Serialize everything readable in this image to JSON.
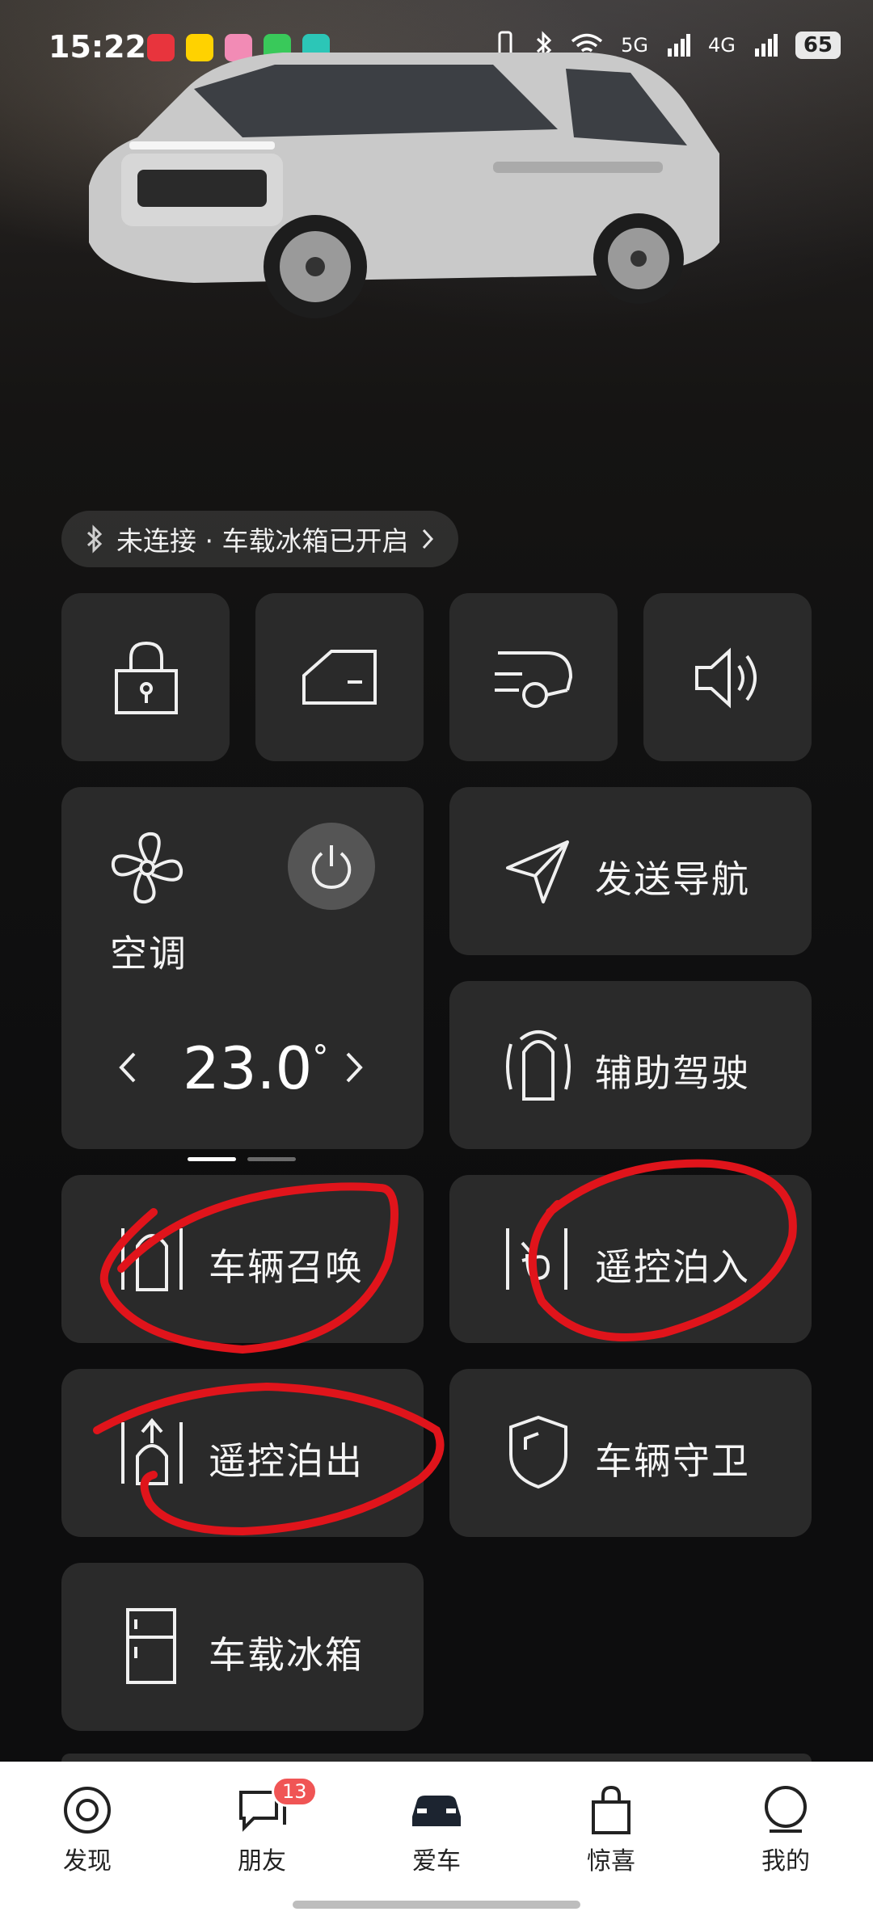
{
  "status_bar": {
    "time": "15:22",
    "battery": "65",
    "network_a": "5G",
    "network_b": "4G"
  },
  "app_icons": [
    {
      "name": "xiaohongshu-app-icon",
      "color": "#e8343d"
    },
    {
      "name": "meituan-app-icon",
      "color": "#ffd200"
    },
    {
      "name": "pink-app-icon",
      "color": "#f28bb5"
    },
    {
      "name": "messages-app-icon",
      "color": "#39c95a"
    },
    {
      "name": "nio-app-icon",
      "color": "#2cc6b7"
    }
  ],
  "connection_pill": {
    "text": "未连接 · 车载冰箱已开启"
  },
  "quick_controls": [
    {
      "name": "lock-icon"
    },
    {
      "name": "door-icon"
    },
    {
      "name": "tailgate-icon"
    },
    {
      "name": "speaker-icon"
    }
  ],
  "climate": {
    "label": "空调",
    "temperature": "23.0",
    "degree_symbol": "°"
  },
  "features": {
    "send_navigation": "发送导航",
    "assisted_driving": "辅助驾驶",
    "vehicle_summon": "车辆召唤",
    "remote_park_in": "遥控泊入",
    "remote_park_out": "遥控泊出",
    "vehicle_guard": "车辆守卫",
    "car_fridge": "车载冰箱"
  },
  "annotation_color": "#e0141b",
  "tabbar": {
    "discover": "发现",
    "friends": "朋友",
    "friends_badge": "13",
    "my_car": "爱车",
    "surprise": "惊喜",
    "mine": "我的"
  }
}
